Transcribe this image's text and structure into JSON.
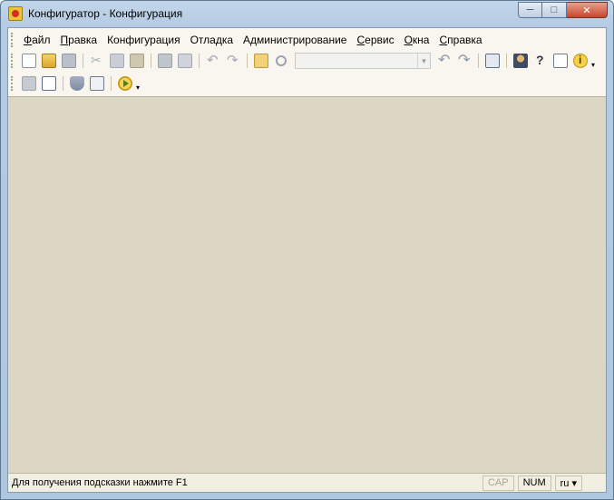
{
  "window": {
    "title": "Конфигуратор - Конфигурация",
    "controls": {
      "minimize": "─",
      "maximize": "□",
      "close": "✕"
    }
  },
  "menu": {
    "items": [
      {
        "underline": "Ф",
        "rest": "айл"
      },
      {
        "underline": "П",
        "rest": "равка"
      },
      {
        "underline": "",
        "rest": "Конфигурация"
      },
      {
        "underline": "",
        "rest": "Отладка"
      },
      {
        "underline": "",
        "rest": "Администрирование"
      },
      {
        "underline": "С",
        "rest": "ервис"
      },
      {
        "underline": "О",
        "rest": "кна"
      },
      {
        "underline": "С",
        "rest": "правка"
      }
    ]
  },
  "toolbar": {
    "search_value": "",
    "drop_arrow": "▾",
    "combo_arrow": "▼",
    "icons_row1": [
      "new-icon",
      "open-icon",
      "save-icon",
      "cut-icon",
      "copy-icon",
      "paste-icon",
      "print-icon",
      "preview-icon",
      "undo-icon",
      "redo-icon",
      "find-icon",
      "search-icon",
      "back-icon",
      "forward-icon",
      "windows-icon",
      "tutor-icon",
      "help-icon",
      "notes-icon",
      "info-icon"
    ],
    "icons_row2": [
      "module-icon",
      "excel-icon",
      "database-icon",
      "form-icon",
      "run-icon"
    ]
  },
  "statusbar": {
    "hint": "Для получения подсказки нажмите F1",
    "cap": "CAP",
    "num": "NUM",
    "lang": "ru ▾"
  }
}
